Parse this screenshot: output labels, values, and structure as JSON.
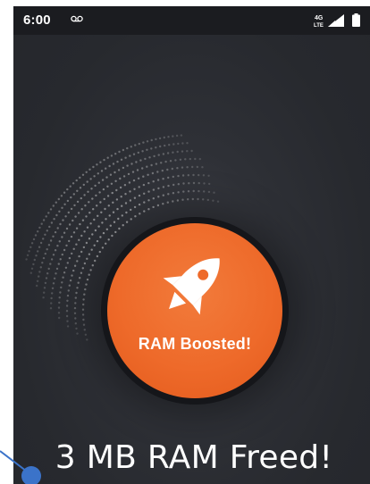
{
  "status_bar": {
    "time": "6:00",
    "voicemail_icon": "voicemail-icon",
    "network_icon": "lte-4g-icon",
    "signal_icon": "cell-signal-icon",
    "battery_icon": "battery-icon"
  },
  "booster": {
    "icon": "rocket-icon",
    "label": "RAM Boosted!",
    "accent_color": "#ee6a2a"
  },
  "result": {
    "text": "3 MB RAM Freed!"
  },
  "colors": {
    "background": "#2b2d33",
    "status_bar": "#1b1c20",
    "pointer": "#3b73c9"
  }
}
